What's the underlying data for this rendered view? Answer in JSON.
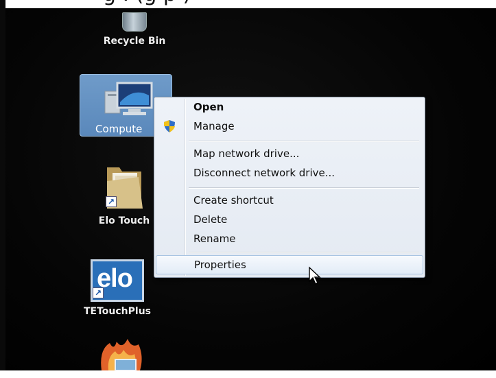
{
  "top_text": "g . (g p )",
  "desktop": {
    "icons": {
      "recycle_bin": "Recycle Bin",
      "computer": "Compute",
      "elo_folder": "Elo Touch",
      "tetouch": "TETouchPlus",
      "elo_logo_text": "elo"
    }
  },
  "context_menu": {
    "items": [
      {
        "label": "Open",
        "bold": true
      },
      {
        "label": "Manage",
        "icon": "uac-shield-icon"
      },
      {
        "label": "Map network drive..."
      },
      {
        "label": "Disconnect network drive..."
      },
      {
        "label": "Create shortcut"
      },
      {
        "label": "Delete"
      },
      {
        "label": "Rename"
      },
      {
        "label": "Properties",
        "highlighted": true
      }
    ]
  },
  "colors": {
    "desktop_bg": "#000000",
    "selection": "#5a88bb",
    "menu_bg": "#eef2f8",
    "highlight_border": "#a8c4e2"
  }
}
